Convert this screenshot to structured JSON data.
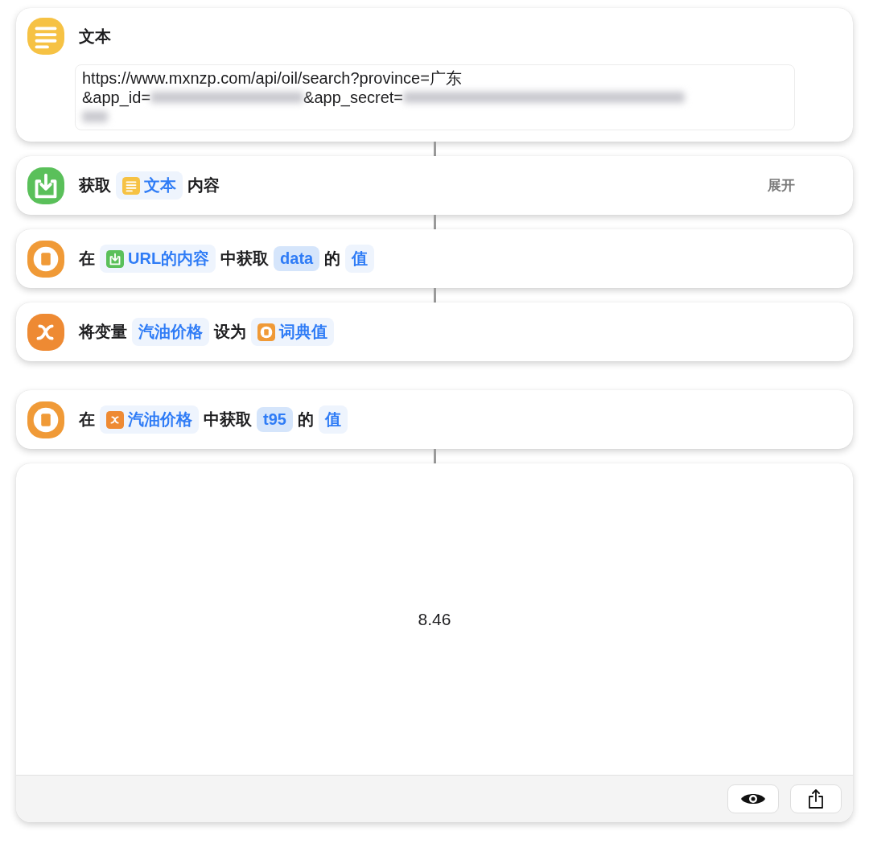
{
  "text_action": {
    "kind": "text",
    "title": "文本",
    "lines": [
      [
        {
          "kind": "text",
          "text": "https://www.mxnzp.com/api/oil/search?province=广东"
        }
      ],
      [
        {
          "kind": "text",
          "text": "&app_id="
        },
        {
          "kind": "redacted"
        },
        {
          "kind": "text",
          "text": "&app_secret="
        },
        {
          "kind": "redacted"
        }
      ],
      [
        {
          "kind": "redacted"
        }
      ]
    ]
  },
  "actions": [
    {
      "kind": "get-contents",
      "gap_before": false,
      "expand_label": "展开",
      "parts": [
        {
          "kind": "text",
          "text": "获取"
        },
        {
          "kind": "text-token",
          "text": "文本",
          "highlighted": false
        },
        {
          "kind": "text",
          "text": "内容"
        }
      ]
    },
    {
      "kind": "dictionary",
      "gap_before": false,
      "parts": [
        {
          "kind": "text",
          "text": "在"
        },
        {
          "kind": "url-token",
          "text": "URL的内容",
          "highlighted": false
        },
        {
          "kind": "text",
          "text": "中获取"
        },
        {
          "kind": "token",
          "text": "data",
          "highlighted": true
        },
        {
          "kind": "text",
          "text": "的"
        },
        {
          "kind": "token",
          "text": "值",
          "highlighted": false
        }
      ]
    },
    {
      "kind": "set-variable",
      "gap_before": false,
      "parts": [
        {
          "kind": "text",
          "text": "将变量"
        },
        {
          "kind": "token",
          "text": "汽油价格",
          "highlighted": false
        },
        {
          "kind": "text",
          "text": "设为"
        },
        {
          "kind": "dict-token",
          "text": "词典值",
          "highlighted": false
        }
      ]
    },
    {
      "kind": "dictionary",
      "gap_before": true,
      "parts": [
        {
          "kind": "text",
          "text": "在"
        },
        {
          "kind": "var-token",
          "text": "汽油价格",
          "highlighted": false
        },
        {
          "kind": "text",
          "text": "中获取"
        },
        {
          "kind": "token",
          "text": "t95",
          "highlighted": true
        },
        {
          "kind": "text",
          "text": "的"
        },
        {
          "kind": "token",
          "text": "值",
          "highlighted": false
        }
      ]
    }
  ],
  "result": {
    "value": "8.46"
  }
}
